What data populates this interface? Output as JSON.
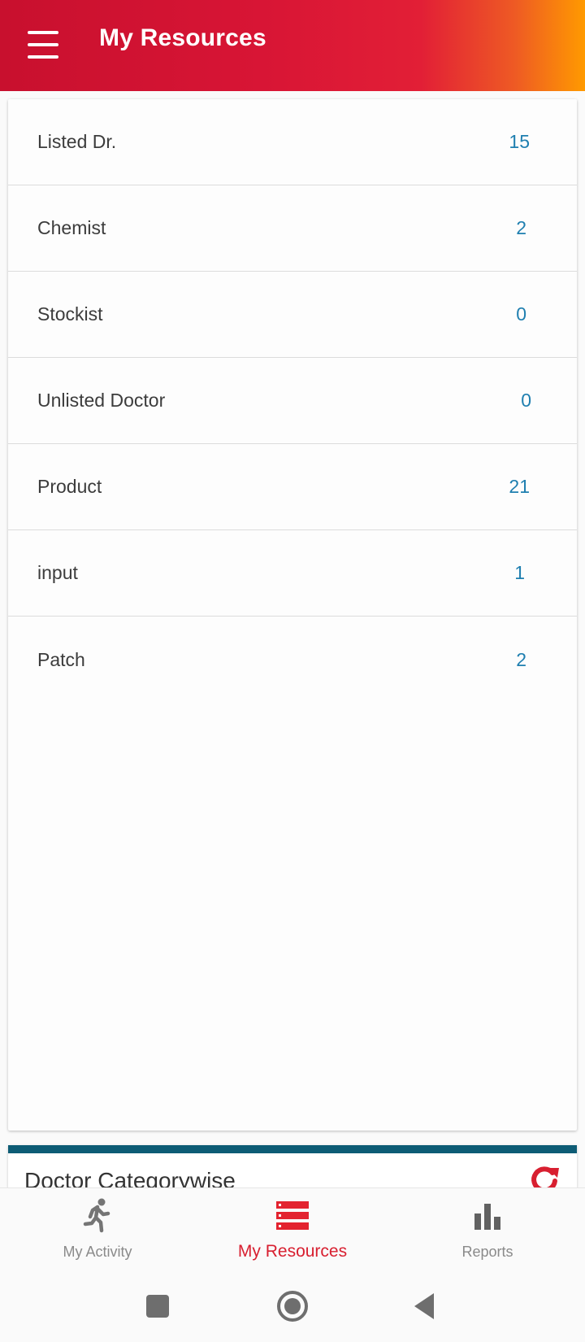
{
  "header": {
    "title": "My Resources",
    "menu_icon": "hamburger-menu-icon"
  },
  "resources": [
    {
      "label": "Listed Dr.",
      "count": "15"
    },
    {
      "label": "Chemist",
      "count": "2"
    },
    {
      "label": "Stockist",
      "count": "0"
    },
    {
      "label": "Unlisted Doctor",
      "count": "0"
    },
    {
      "label": "Product",
      "count": "21"
    },
    {
      "label": "input",
      "count": "1"
    },
    {
      "label": "Patch",
      "count": "2"
    }
  ],
  "category_section": {
    "title": "Doctor Categorywise",
    "refresh_icon": "refresh-icon"
  },
  "bottom_nav": {
    "items": [
      {
        "label": "My Activity",
        "icon": "running-person-icon",
        "active": false
      },
      {
        "label": "My Resources",
        "icon": "list-icon",
        "active": true
      },
      {
        "label": "Reports",
        "icon": "bar-chart-icon",
        "active": false
      }
    ]
  },
  "colors": {
    "brand_red": "#d81f30",
    "brand_orange": "#ff9a00",
    "count_blue": "#1f7fb0",
    "section_teal": "#0d5c75"
  }
}
